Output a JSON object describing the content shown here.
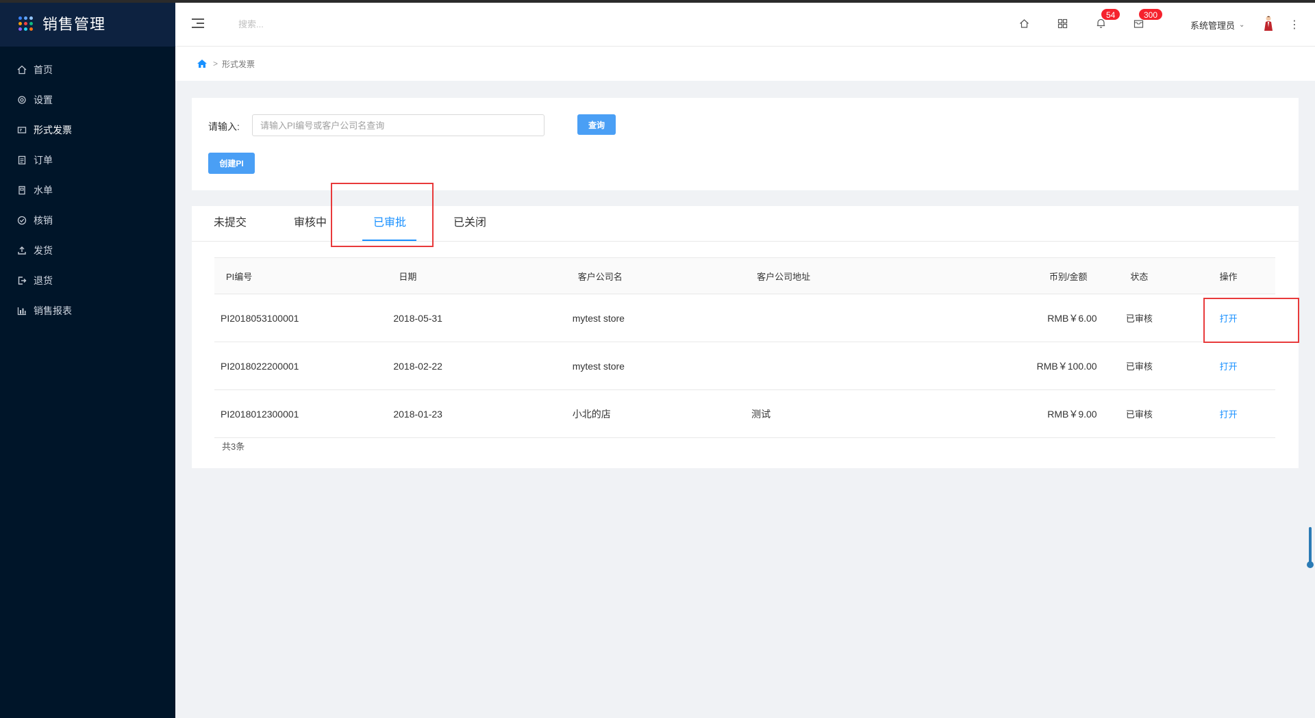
{
  "app": {
    "title": "销售管理",
    "brand_colors": [
      "#3b82f6",
      "#60a5fa",
      "#93c5fd",
      "#f59e0b",
      "#ef4444",
      "#10b981",
      "#8b5cf6",
      "#22d3ee",
      "#f97316"
    ]
  },
  "sidebar": {
    "items": [
      {
        "label": "首页",
        "icon": "home-icon"
      },
      {
        "label": "设置",
        "icon": "gear-icon"
      },
      {
        "label": "形式发票",
        "icon": "invoice-icon"
      },
      {
        "label": "订单",
        "icon": "order-icon"
      },
      {
        "label": "水单",
        "icon": "receipt-icon"
      },
      {
        "label": "核销",
        "icon": "check-circle-icon"
      },
      {
        "label": "发货",
        "icon": "upload-icon"
      },
      {
        "label": "退货",
        "icon": "logout-icon"
      },
      {
        "label": "销售报表",
        "icon": "bar-chart-icon"
      }
    ]
  },
  "header": {
    "search_placeholder": "搜索...",
    "notifications_count": "54",
    "messages_count": "300",
    "user_name": "系统管理员"
  },
  "breadcrumb": {
    "current": "形式发票",
    "separator": ">"
  },
  "query": {
    "label": "请输入:",
    "placeholder": "请输入PI编号或客户公司名查询",
    "value": "",
    "search_button": "查询",
    "create_button": "创建PI"
  },
  "tabs": [
    {
      "label": "未提交"
    },
    {
      "label": "审核中"
    },
    {
      "label": "已审批"
    },
    {
      "label": "已关闭"
    }
  ],
  "active_tab": "已审批",
  "table": {
    "columns": [
      "PI编号",
      "日期",
      "客户公司名",
      "客户公司地址",
      "币别/金额",
      "状态",
      "操作"
    ],
    "rows": [
      {
        "id": "PI2018053100001",
        "date": "2018-05-31",
        "customer": "mytest store",
        "address": "",
        "amount": "RMB￥6.00",
        "status": "已审核",
        "action": "打开"
      },
      {
        "id": "PI2018022200001",
        "date": "2018-02-22",
        "customer": "mytest store",
        "address": "",
        "amount": "RMB￥100.00",
        "status": "已审核",
        "action": "打开"
      },
      {
        "id": "PI2018012300001",
        "date": "2018-01-23",
        "customer": "小北的店",
        "address": "测试",
        "amount": "RMB￥9.00",
        "status": "已审核",
        "action": "打开"
      }
    ],
    "total": "共3条"
  },
  "colors": {
    "sidebar_bg": "#001529",
    "accent": "#1890ff",
    "button": "#4a9ff5",
    "highlight": "#e8393a",
    "badge": "#f5222d"
  }
}
